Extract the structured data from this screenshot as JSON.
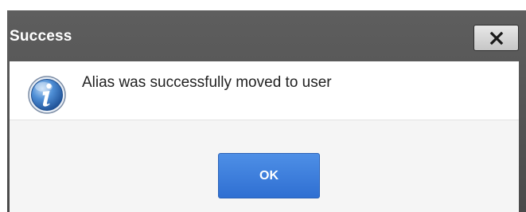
{
  "dialog": {
    "title": "Success",
    "close_icon": "close-icon",
    "info_icon": "info-icon",
    "message": "Alias was successfully moved to user",
    "ok_label": "OK"
  },
  "colors": {
    "titlebar": "#4f4f4f",
    "ok_button": "#3a7ddb",
    "content_bg": "#ffffff",
    "button_area_bg": "#f5f5f5"
  }
}
